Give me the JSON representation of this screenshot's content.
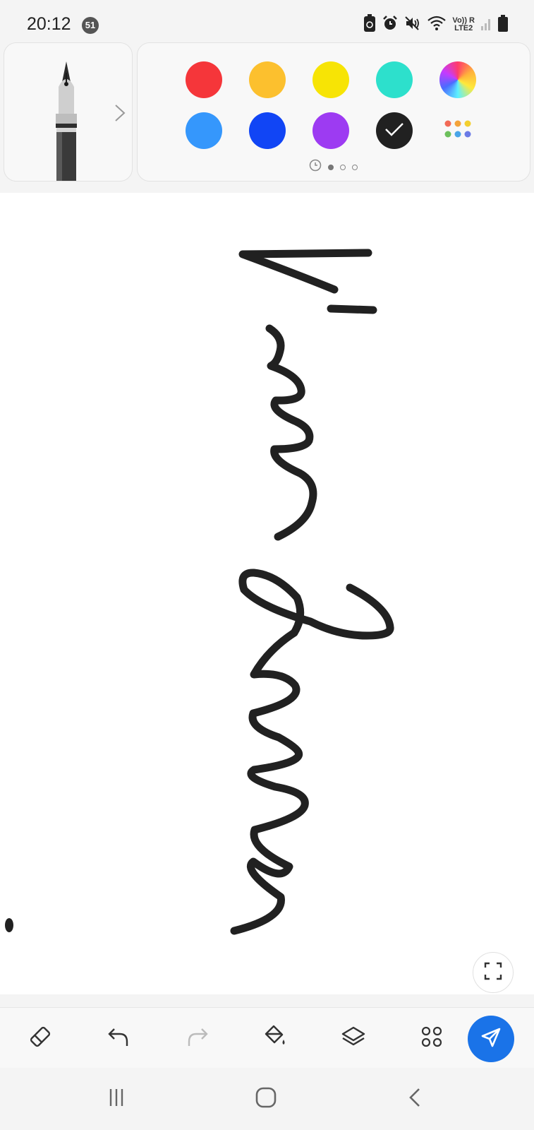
{
  "status_bar": {
    "time": "20:12",
    "notification_count": "51",
    "network_top": "Vo)) R",
    "network_bottom": "LTE2",
    "icons": [
      "battery-saver-icon",
      "alarm-icon",
      "mute-icon",
      "wifi-icon",
      "signal-icon",
      "battery-icon"
    ]
  },
  "pen_panel": {
    "selected_tool": "fountain-pen-icon",
    "expand_icon": "chevron-right-icon"
  },
  "color_palette": {
    "colors": [
      {
        "name": "red",
        "hex": "#f5363a",
        "selected": false
      },
      {
        "name": "orange",
        "hex": "#fcc02e",
        "selected": false
      },
      {
        "name": "yellow",
        "hex": "#f7e405",
        "selected": false
      },
      {
        "name": "teal",
        "hex": "#2de0cc",
        "selected": false
      },
      {
        "name": "spectrum",
        "hex": "gradient",
        "selected": false
      },
      {
        "name": "light-blue",
        "hex": "#3597fc",
        "selected": false
      },
      {
        "name": "blue",
        "hex": "#1145f5",
        "selected": false
      },
      {
        "name": "purple",
        "hex": "#9d3bf2",
        "selected": false
      },
      {
        "name": "black",
        "hex": "#212121",
        "selected": true
      },
      {
        "name": "more-colors",
        "hex": "grid",
        "selected": false
      }
    ],
    "pages": {
      "recent_icon": "clock-icon",
      "count": 3,
      "active": 0
    }
  },
  "canvas": {
    "background": "#ffffff",
    "ink_color": "#212121"
  },
  "toolbar": {
    "tools": [
      "eraser-icon",
      "undo-icon",
      "redo-icon",
      "fill-bucket-icon",
      "layers-icon",
      "more-apps-icon"
    ],
    "redo_enabled": false,
    "send_icon": "send-icon",
    "accent": "#1a73e8"
  },
  "navigation": {
    "buttons": [
      "recents-icon",
      "home-icon",
      "back-icon"
    ]
  }
}
